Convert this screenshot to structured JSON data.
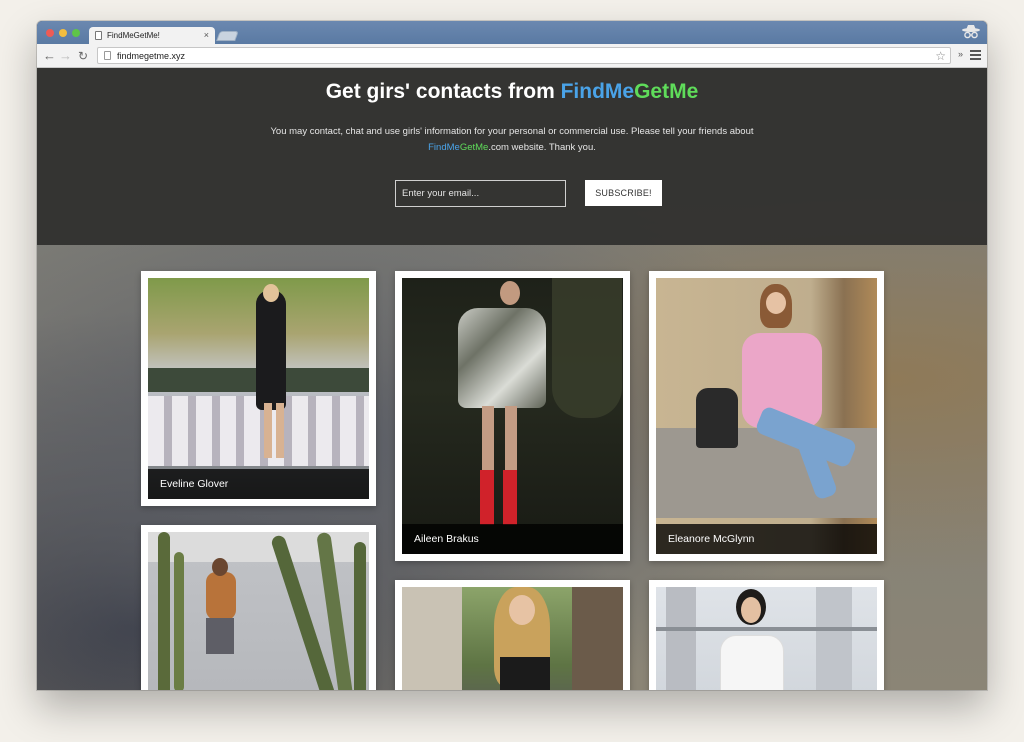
{
  "browser": {
    "tab_title": "FindMeGetMe!",
    "tab_close": "×",
    "url": "findmegetme.xyz",
    "extensions_label": "»"
  },
  "hero": {
    "title_prefix": "Get girs' contacts from ",
    "brand_part1": "FindMe",
    "brand_part2": "GetMe",
    "desc_line1": "You may contact, chat and use girls' information for your personal or commercial use. Please tell your friends about",
    "desc_brand_part1": "FindMe",
    "desc_brand_part2": "GetMe",
    "desc_suffix": ".com website. Thank you.",
    "email_placeholder": "Enter your email...",
    "subscribe_label": "SUBSCRIBE!"
  },
  "profiles": [
    {
      "name": "Eveline Glover"
    },
    {
      "name": "Aileen Brakus"
    },
    {
      "name": "Eleanore McGlynn"
    },
    {
      "name": ""
    },
    {
      "name": ""
    },
    {
      "name": ""
    }
  ],
  "colors": {
    "brand_blue": "#4aa3e8",
    "brand_green": "#5fdc5a",
    "hero_bg": "#30302e"
  }
}
